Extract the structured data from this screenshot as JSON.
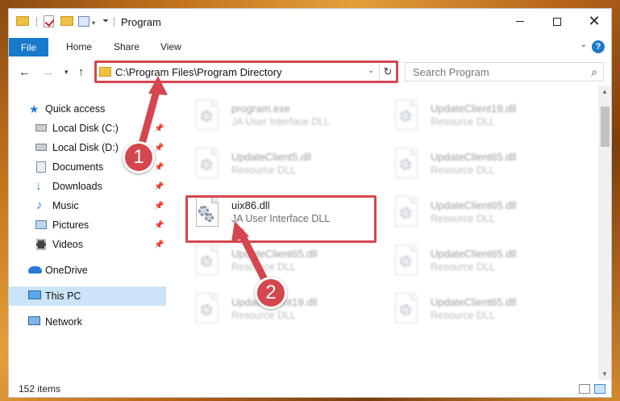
{
  "window": {
    "title": "Program"
  },
  "ribbon": {
    "tabs": [
      "File",
      "Home",
      "Share",
      "View"
    ],
    "help": "?"
  },
  "address": {
    "path": "C:\\Program Files\\Program Directory"
  },
  "search": {
    "placeholder": "Search Program"
  },
  "navigation": {
    "items": [
      {
        "label": "Quick access",
        "icon": "star-icon"
      },
      {
        "label": "Local Disk (C:)",
        "icon": "drive-icon",
        "pinned": true
      },
      {
        "label": "Local Disk (D:)",
        "icon": "drive-icon",
        "pinned": true
      },
      {
        "label": "Documents",
        "icon": "documents-icon",
        "pinned": true
      },
      {
        "label": "Downloads",
        "icon": "download-icon",
        "pinned": true
      },
      {
        "label": "Music",
        "icon": "music-icon",
        "pinned": true
      },
      {
        "label": "Pictures",
        "icon": "pictures-icon",
        "pinned": true
      },
      {
        "label": "Videos",
        "icon": "videos-icon",
        "pinned": true
      },
      {
        "label": "OneDrive",
        "icon": "cloud-icon"
      },
      {
        "label": "This PC",
        "icon": "computer-icon",
        "selected": true
      },
      {
        "label": "Network",
        "icon": "network-icon"
      }
    ]
  },
  "files": [
    {
      "name": "program.exe",
      "type": "JA User Interface DLL",
      "blurred": true
    },
    {
      "name": "UpdateClient19.dll",
      "type": "Resource DLL",
      "blurred": true
    },
    {
      "name": "UpdateClient5.dll",
      "type": "Resource DLL",
      "blurred": true
    },
    {
      "name": "UpdateClient65.dll",
      "type": "Resource DLL",
      "blurred": true
    },
    {
      "name": "uix86.dll",
      "type": "JA User Interface DLL",
      "blurred": false
    },
    {
      "name": "UpdateClient65.dll",
      "type": "Resource DLL",
      "blurred": true
    },
    {
      "name": "UpdateClient65.dll",
      "type": "Resource DLL",
      "blurred": true
    },
    {
      "name": "UpdateClient65.dll",
      "type": "Resource DLL",
      "blurred": true
    },
    {
      "name": "UpdateClient19.dll",
      "type": "Resource DLL",
      "blurred": true
    },
    {
      "name": "UpdateClient65.dll",
      "type": "Resource DLL",
      "blurred": true
    }
  ],
  "status": {
    "item_count": "152 items"
  },
  "annotations": {
    "step1": "1",
    "step2": "2",
    "color": "#d4474f"
  }
}
